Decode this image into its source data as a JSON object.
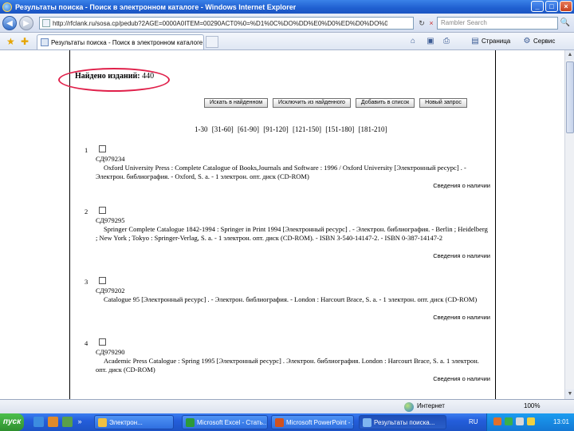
{
  "window": {
    "title": "Результаты поиска - Поиск в электронном каталоге - Windows Internet Explorer",
    "min": "_",
    "max": "□",
    "close": "×"
  },
  "navbar": {
    "back": "◀",
    "forward": "▶",
    "url": "http://rfclank.ru/sosa.cp/pedub?2AGE=0000A0ITEM=00290ACT0%0=%D1%0C%DO%DD%E0%D0%ED%D0%DO%0D",
    "refresh": "↻",
    "stop": "×",
    "search_placeholder": "Rambler Search",
    "search_icon": "🔍"
  },
  "cmdbar": {
    "tab_label": "Результаты поиска - Поиск в электронном каталоге",
    "page_menu": "Страница",
    "tools_menu": "Сервис"
  },
  "results": {
    "found_label": "Найдено изданий:",
    "found_count": "440",
    "buttons": [
      "Искать в найденном",
      "Исключить из найденного",
      "Добавить в список",
      "Новый запрос"
    ],
    "pager": [
      "1-30",
      "[31-60]",
      "[61-90]",
      "[91-120]",
      "[121-150]",
      "[151-180]",
      "[181-210]"
    ],
    "availability_label": "Сведения о наличии",
    "records": [
      {
        "num": "1",
        "code": "СД979234",
        "desc": "Oxford University Press : Complete Catalogue of Books,Journals and Software : 1996 / Oxford University [Электронный ресурс] . - Электрон. библиография. - Oxford, S. a. - 1 электрон. опт. диск (CD-ROM)"
      },
      {
        "num": "2",
        "code": "СД979295",
        "desc": "Springer Complete Catalogue 1842-1994 : Springer in Print 1994 [Электронный ресурс] . - Электрон. библиография. - Berlin ; Heidelberg ; New York ; Tokyo : Springer-Verlag, S. a. - 1 электрон. опт. диск (CD-ROM). - ISBN 3-540-14147-2. - ISBN 0-387-14147-2"
      },
      {
        "num": "3",
        "code": "СД979202",
        "desc": "Catalogue 95 [Электронный ресурс] . - Электрон. библиография. - London : Harcourt Brace, S. a. - 1 электрон. опт. диск (CD-ROM)"
      },
      {
        "num": "4",
        "code": "СД979290",
        "desc": "Academic Press Catalogue : Spring 1995 [Электронный ресурс] . Электрон. библиография. London : Harcourt Brace, S. a. 1 электрон. опт. диск (CD-ROM)"
      }
    ]
  },
  "statusbar": {
    "zone": "Интернет",
    "zoom": "100%"
  },
  "taskbar": {
    "start": "пуск",
    "items": [
      {
        "label": "Электрон...",
        "color": "#f0c040"
      },
      {
        "label": "Microsoft Excel - Стать...",
        "color": "#2c9a3a"
      },
      {
        "label": "Microsoft PowerPoint - ...",
        "color": "#d2521e"
      },
      {
        "label": "Результаты поиска...",
        "color": "#7fb6f0"
      }
    ],
    "lang": "RU",
    "clock": "13:01"
  }
}
